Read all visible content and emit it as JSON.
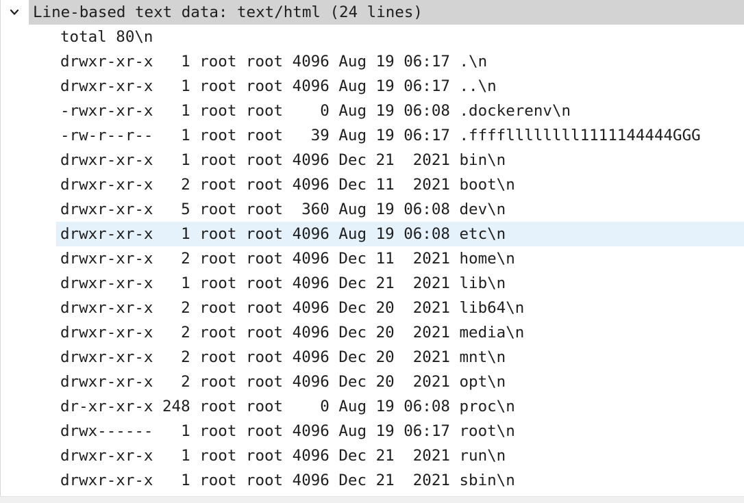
{
  "header": {
    "title": "Line-based text data: text/html (24 lines)",
    "toggle_icon": "chevron-down-icon"
  },
  "selected_line_index": 8,
  "colors": {
    "header_bg": "#d3d3d3",
    "selected_bg": "#e5f1fb"
  },
  "lines": [
    "total 80\\n",
    "drwxr-xr-x   1 root root 4096 Aug 19 06:17 .\\n",
    "drwxr-xr-x   1 root root 4096 Aug 19 06:17 ..\\n",
    "-rwxr-xr-x   1 root root    0 Aug 19 06:08 .dockerenv\\n",
    "-rw-r--r--   1 root root   39 Aug 19 06:17 .ffffllllllll1111144444GGG",
    "drwxr-xr-x   1 root root 4096 Dec 21  2021 bin\\n",
    "drwxr-xr-x   2 root root 4096 Dec 11  2021 boot\\n",
    "drwxr-xr-x   5 root root  360 Aug 19 06:08 dev\\n",
    "drwxr-xr-x   1 root root 4096 Aug 19 06:08 etc\\n",
    "drwxr-xr-x   2 root root 4096 Dec 11  2021 home\\n",
    "drwxr-xr-x   1 root root 4096 Dec 21  2021 lib\\n",
    "drwxr-xr-x   2 root root 4096 Dec 20  2021 lib64\\n",
    "drwxr-xr-x   2 root root 4096 Dec 20  2021 media\\n",
    "drwxr-xr-x   2 root root 4096 Dec 20  2021 mnt\\n",
    "drwxr-xr-x   2 root root 4096 Dec 20  2021 opt\\n",
    "dr-xr-xr-x 248 root root    0 Aug 19 06:08 proc\\n",
    "drwx------   1 root root 4096 Aug 19 06:17 root\\n",
    "drwxr-xr-x   1 root root 4096 Dec 21  2021 run\\n",
    "drwxr-xr-x   1 root root 4096 Dec 21  2021 sbin\\n"
  ]
}
